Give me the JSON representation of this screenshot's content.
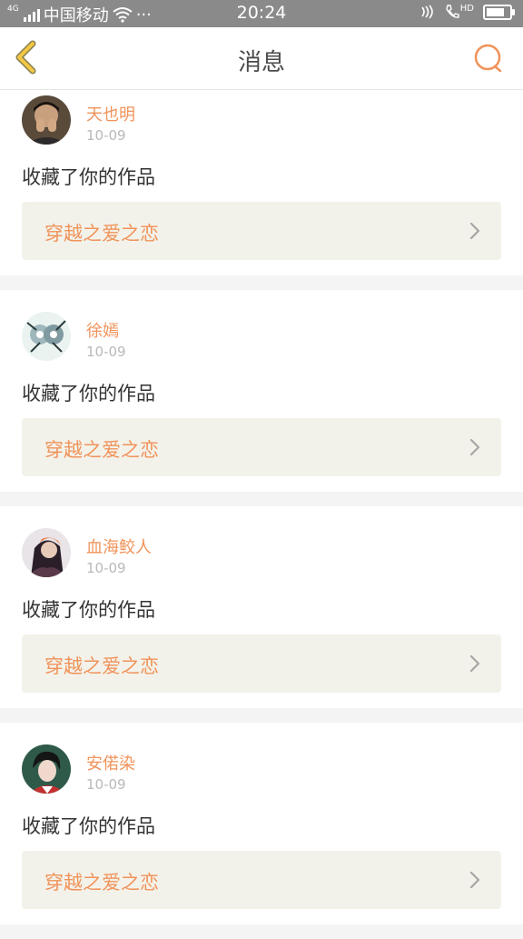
{
  "status_bar": {
    "network": "4G",
    "carrier": "中国移动",
    "more": "···",
    "time": "20:24",
    "hd_label": "HD",
    "battery_level": 0.85
  },
  "header": {
    "title": "消息",
    "back_icon": "chevron-left-icon",
    "search_icon": "search-icon",
    "accent_color": "#f0935a"
  },
  "messages": [
    {
      "user": "天也明",
      "date": "10-09",
      "action": "收藏了你的作品",
      "work": "穿越之爱之恋"
    },
    {
      "user": "徐嫣",
      "date": "10-09",
      "action": "收藏了你的作品",
      "work": "穿越之爱之恋"
    },
    {
      "user": "血海鲛人",
      "date": "10-09",
      "action": "收藏了你的作品",
      "work": "穿越之爱之恋"
    },
    {
      "user": "安偌染",
      "date": "10-09",
      "action": "收藏了你的作品",
      "work": "穿越之爱之恋"
    }
  ]
}
